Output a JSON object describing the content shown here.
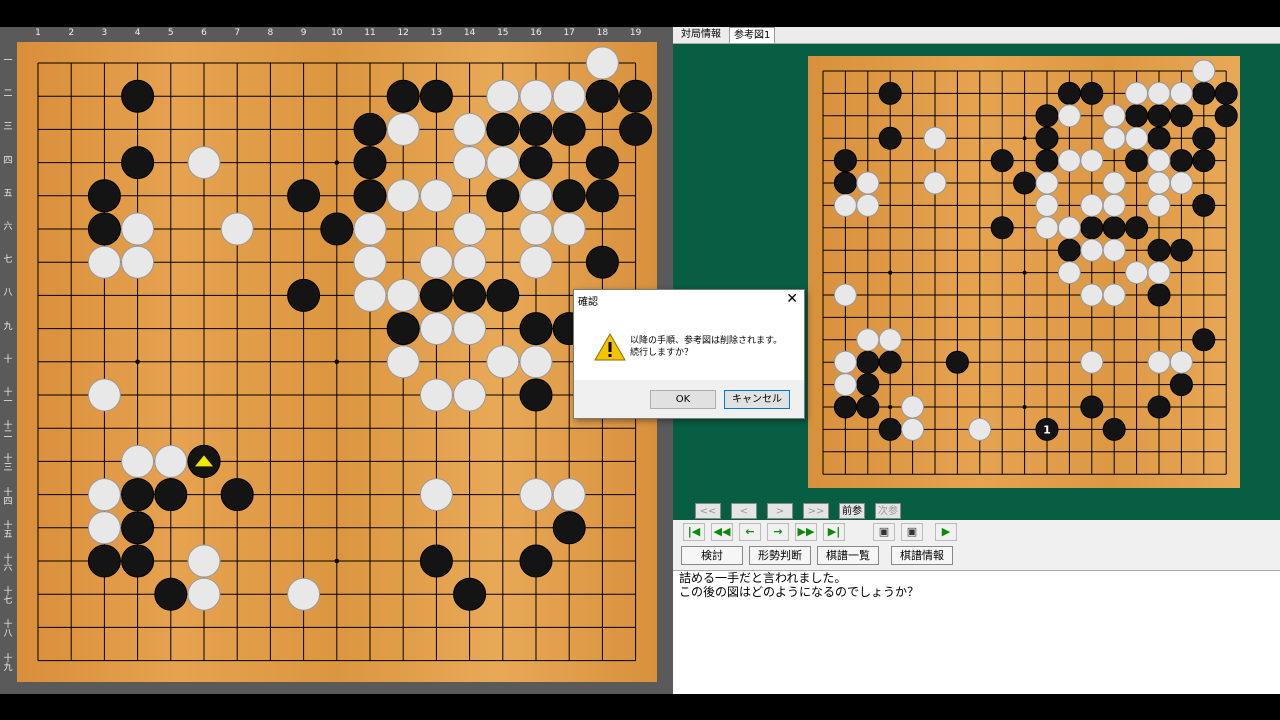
{
  "coords": {
    "columns": [
      "1",
      "2",
      "3",
      "4",
      "5",
      "6",
      "7",
      "8",
      "9",
      "10",
      "11",
      "12",
      "13",
      "14",
      "15",
      "16",
      "17",
      "18",
      "19"
    ],
    "rows": [
      "一",
      "二",
      "三",
      "四",
      "五",
      "六",
      "七",
      "八",
      "九",
      "十",
      "十一",
      "十二",
      "十三",
      "十四",
      "十五",
      "十六",
      "十七",
      "十八",
      "十九"
    ]
  },
  "main_board": {
    "size": 19,
    "black": [
      [
        4,
        2
      ],
      [
        12,
        2
      ],
      [
        13,
        2
      ],
      [
        18,
        2
      ],
      [
        19,
        2
      ],
      [
        11,
        3
      ],
      [
        15,
        3
      ],
      [
        16,
        3
      ],
      [
        17,
        3
      ],
      [
        19,
        3
      ],
      [
        4,
        4
      ],
      [
        11,
        4
      ],
      [
        16,
        4
      ],
      [
        18,
        4
      ],
      [
        3,
        5
      ],
      [
        9,
        5
      ],
      [
        11,
        5
      ],
      [
        15,
        5
      ],
      [
        17,
        5
      ],
      [
        18,
        5
      ],
      [
        3,
        6
      ],
      [
        10,
        6
      ],
      [
        18,
        7
      ],
      [
        9,
        8
      ],
      [
        13,
        8
      ],
      [
        14,
        8
      ],
      [
        15,
        8
      ],
      [
        12,
        9
      ],
      [
        16,
        9
      ],
      [
        17,
        9
      ],
      [
        16,
        11
      ],
      [
        6,
        13
      ],
      [
        4,
        14
      ],
      [
        5,
        14
      ],
      [
        7,
        14
      ],
      [
        4,
        15
      ],
      [
        17,
        15
      ],
      [
        3,
        16
      ],
      [
        4,
        16
      ],
      [
        13,
        16
      ],
      [
        16,
        16
      ],
      [
        5,
        17
      ],
      [
        14,
        17
      ]
    ],
    "white": [
      [
        18,
        1
      ],
      [
        15,
        2
      ],
      [
        16,
        2
      ],
      [
        17,
        2
      ],
      [
        12,
        3
      ],
      [
        14,
        3
      ],
      [
        6,
        4
      ],
      [
        14,
        4
      ],
      [
        15,
        4
      ],
      [
        12,
        5
      ],
      [
        13,
        5
      ],
      [
        16,
        5
      ],
      [
        4,
        6
      ],
      [
        7,
        6
      ],
      [
        11,
        6
      ],
      [
        14,
        6
      ],
      [
        16,
        6
      ],
      [
        17,
        6
      ],
      [
        3,
        7
      ],
      [
        4,
        7
      ],
      [
        11,
        7
      ],
      [
        13,
        7
      ],
      [
        14,
        7
      ],
      [
        16,
        7
      ],
      [
        11,
        8
      ],
      [
        12,
        8
      ],
      [
        13,
        9
      ],
      [
        14,
        9
      ],
      [
        12,
        10
      ],
      [
        15,
        10
      ],
      [
        16,
        10
      ],
      [
        3,
        11
      ],
      [
        13,
        11
      ],
      [
        14,
        11
      ],
      [
        4,
        13
      ],
      [
        5,
        13
      ],
      [
        3,
        14
      ],
      [
        13,
        14
      ],
      [
        16,
        14
      ],
      [
        17,
        14
      ],
      [
        3,
        15
      ],
      [
        6,
        16
      ],
      [
        6,
        17
      ],
      [
        9,
        17
      ]
    ],
    "last_move_marker": [
      6,
      13
    ],
    "marker_color": "#f2e600"
  },
  "tabs": {
    "info": "対局情報",
    "ref": "参考図1"
  },
  "ref_board": {
    "size": 19,
    "black": [
      [
        4,
        2
      ],
      [
        12,
        2
      ],
      [
        13,
        2
      ],
      [
        18,
        2
      ],
      [
        19,
        2
      ],
      [
        11,
        3
      ],
      [
        15,
        3
      ],
      [
        16,
        3
      ],
      [
        17,
        3
      ],
      [
        19,
        3
      ],
      [
        4,
        4
      ],
      [
        11,
        4
      ],
      [
        16,
        4
      ],
      [
        18,
        4
      ],
      [
        2,
        5
      ],
      [
        9,
        5
      ],
      [
        11,
        5
      ],
      [
        15,
        5
      ],
      [
        17,
        5
      ],
      [
        18,
        5
      ],
      [
        2,
        6
      ],
      [
        10,
        6
      ],
      [
        18,
        7
      ],
      [
        9,
        8
      ],
      [
        13,
        8
      ],
      [
        14,
        8
      ],
      [
        15,
        8
      ],
      [
        12,
        9
      ],
      [
        16,
        9
      ],
      [
        17,
        9
      ],
      [
        16,
        11
      ],
      [
        18,
        13
      ],
      [
        3,
        14
      ],
      [
        4,
        14
      ],
      [
        7,
        14
      ],
      [
        3,
        15
      ],
      [
        17,
        15
      ],
      [
        2,
        16
      ],
      [
        3,
        16
      ],
      [
        13,
        16
      ],
      [
        16,
        16
      ],
      [
        4,
        17
      ],
      [
        14,
        17
      ]
    ],
    "white": [
      [
        18,
        1
      ],
      [
        15,
        2
      ],
      [
        16,
        2
      ],
      [
        17,
        2
      ],
      [
        12,
        3
      ],
      [
        14,
        3
      ],
      [
        6,
        4
      ],
      [
        14,
        4
      ],
      [
        15,
        4
      ],
      [
        12,
        5
      ],
      [
        13,
        5
      ],
      [
        16,
        5
      ],
      [
        3,
        6
      ],
      [
        6,
        6
      ],
      [
        11,
        6
      ],
      [
        14,
        6
      ],
      [
        16,
        6
      ],
      [
        17,
        6
      ],
      [
        2,
        7
      ],
      [
        3,
        7
      ],
      [
        11,
        7
      ],
      [
        13,
        7
      ],
      [
        14,
        7
      ],
      [
        16,
        7
      ],
      [
        11,
        8
      ],
      [
        12,
        8
      ],
      [
        13,
        9
      ],
      [
        14,
        9
      ],
      [
        12,
        10
      ],
      [
        15,
        10
      ],
      [
        16,
        10
      ],
      [
        2,
        11
      ],
      [
        13,
        11
      ],
      [
        14,
        11
      ],
      [
        3,
        13
      ],
      [
        4,
        13
      ],
      [
        2,
        14
      ],
      [
        13,
        14
      ],
      [
        16,
        14
      ],
      [
        17,
        14
      ],
      [
        2,
        15
      ],
      [
        5,
        16
      ],
      [
        5,
        17
      ],
      [
        8,
        17
      ]
    ],
    "numbered": [
      {
        "x": 11,
        "y": 17,
        "label": "1",
        "color": "black"
      }
    ]
  },
  "nav_buttons": [
    "<<",
    "<",
    ">",
    ">>",
    "前参",
    "次参"
  ],
  "toolbar_icons": [
    "first-icon",
    "fast-back-icon",
    "back-icon",
    "forward-icon",
    "fast-forward-icon",
    "last-icon",
    "export-icon",
    "import-icon",
    "play-icon"
  ],
  "func_buttons": {
    "review": "検討",
    "judge": "形勢判断",
    "list": "棋譜一覧",
    "info": "棋譜情報"
  },
  "comment": {
    "line1": "詰める一手だと言われました。",
    "line2": "この後の図はどのようになるのでしょうか？"
  },
  "dialog": {
    "title": "確認",
    "message_line1": "以降の手順、参考図は削除されます。",
    "message_line2": "続行しますか？",
    "ok_label": "OK",
    "cancel_label": "キャンセル"
  }
}
